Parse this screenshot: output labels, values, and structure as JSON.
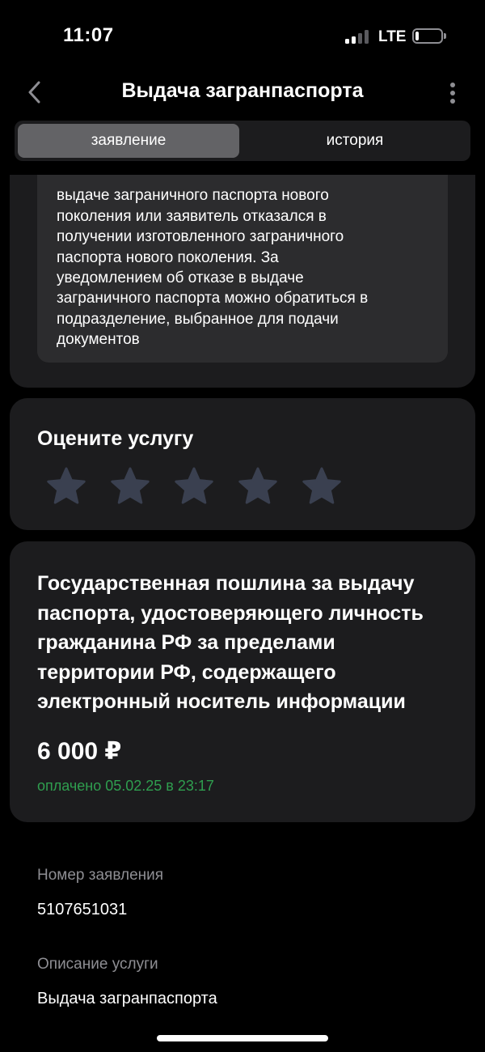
{
  "status_bar": {
    "time": "11:07",
    "network": "LTE",
    "signal_bars_active": 2,
    "signal_bars_total": 4,
    "battery_level": 0.12
  },
  "nav": {
    "title": "Выдача загранпаспорта",
    "back_icon": "chevron-left-icon",
    "more_icon": "more-vertical-icon"
  },
  "tabs": [
    {
      "label": "заявление",
      "active": true
    },
    {
      "label": "история",
      "active": false
    }
  ],
  "status_message": {
    "lines_visible": [
      "выдаче заграничного паспорта нового",
      "поколения или заявитель отказался в",
      "получении изготовленного заграничного",
      "паспорта нового поколения. За",
      "уведомлением об отказе в выдаче",
      "заграничного паспорта можно обратиться в",
      "подразделение, выбранное для подачи",
      "документов"
    ]
  },
  "rating": {
    "title": "Оцените услугу",
    "stars_total": 5,
    "stars_selected": 0
  },
  "fee": {
    "title": "Государственная пошлина за выдачу паспорта, удостоверяющего личность гражданина РФ за пределами территории РФ, содержащего электронный носитель информации",
    "amount": "6 000 ₽",
    "status": "оплачено 05.02.25 в 23:17"
  },
  "details": [
    {
      "label": "Номер заявления",
      "value": "5107651031"
    },
    {
      "label": "Описание услуги",
      "value": "Выдача загранпаспорта"
    }
  ],
  "colors": {
    "background": "#000000",
    "card": "#1c1c1e",
    "inner_card": "#2c2c2e",
    "segment_active": "#636366",
    "star": "#3a4050",
    "secondary_text": "#8e8e93",
    "paid_green": "#2f9e4f"
  }
}
